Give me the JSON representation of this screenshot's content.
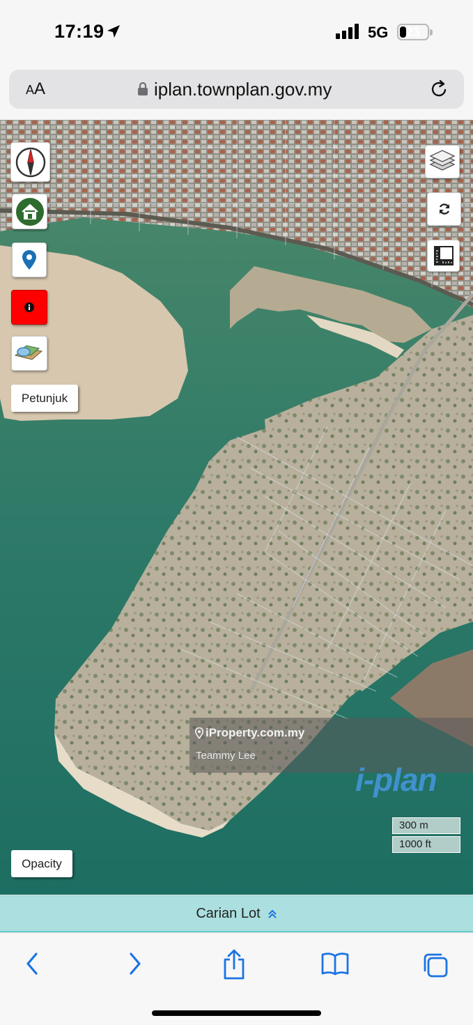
{
  "status_bar": {
    "time": "17:19",
    "network": "5G",
    "battery_level": "23",
    "battery_fraction": 0.23,
    "icons": [
      "location-arrow-icon",
      "signal-bars-icon",
      "battery-icon"
    ]
  },
  "browser": {
    "text_size_button": "AA",
    "url": "iplan.townplan.gov.my",
    "icons": [
      "lock-icon",
      "reload-icon"
    ]
  },
  "map": {
    "base_layer": "satellite",
    "controls_left": [
      "compass-icon",
      "home-icon",
      "location-pin-icon",
      "info-icon",
      "layers-map-icon"
    ],
    "controls_right": [
      "layers-icon",
      "refresh-icon",
      "measure-icon"
    ],
    "info_button_color": "#ff0000",
    "home_icon_color": "#2e6b2e",
    "pin_color": "#1a6fb5",
    "petunjuk_label": "Petunjuk",
    "opacity_label": "Opacity",
    "watermark": {
      "brand": "iProperty.com.my",
      "user": "Teammy Lee",
      "logo": "i-plan"
    },
    "scale": {
      "metric": "300 m",
      "imperial": "1000 ft"
    }
  },
  "bottom_panel": {
    "label": "Carian Lot"
  },
  "safari_toolbar": {
    "icons": [
      "back-icon",
      "forward-icon",
      "share-icon",
      "bookmarks-icon",
      "tabs-icon"
    ],
    "accent_color": "#1b74e4"
  }
}
